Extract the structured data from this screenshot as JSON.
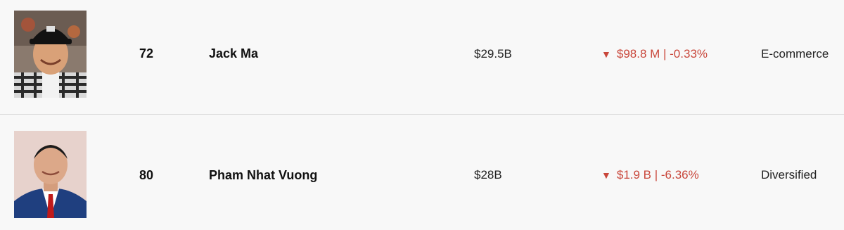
{
  "colors": {
    "background": "#f8f8f8",
    "divider": "#d9d9d9",
    "negative": "#c9473b"
  },
  "rows": [
    {
      "rank": "72",
      "name": "Jack Ma",
      "net_worth": "$29.5B",
      "change_icon": "down-triangle-icon",
      "change_arrow": "▼",
      "change_text": "$98.8 M | -0.33%",
      "industry": "E-commerce"
    },
    {
      "rank": "80",
      "name": "Pham Nhat Vuong",
      "net_worth": "$28B",
      "change_icon": "down-triangle-icon",
      "change_arrow": "▼",
      "change_text": "$1.9 B | -6.36%",
      "industry": "Diversified"
    }
  ]
}
